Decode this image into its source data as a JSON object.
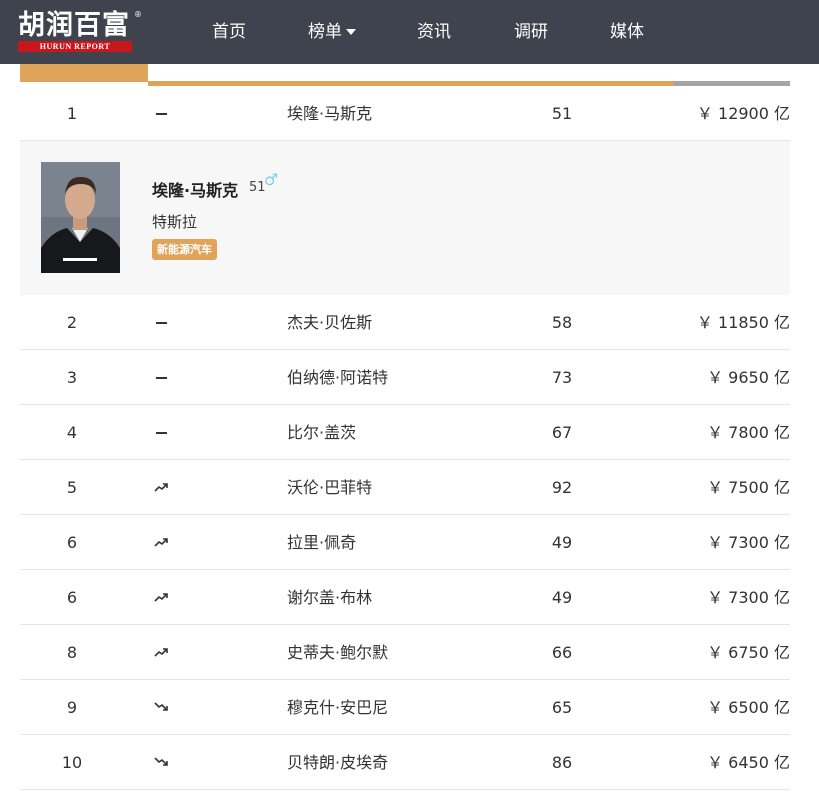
{
  "header": {
    "logo_cn": "胡润百富",
    "logo_en": "HURUN REPORT",
    "logo_reg": "®",
    "nav": [
      {
        "label": "首页"
      },
      {
        "label": "榜单"
      },
      {
        "label": "资讯"
      },
      {
        "label": "调研"
      },
      {
        "label": "媒体"
      }
    ]
  },
  "colors": {
    "header_bg": "#3e434d",
    "accent": "#e0a35a",
    "logo_red": "#c8161d",
    "gender_male": "#7fd0ea"
  },
  "detail": {
    "name": "埃隆·马斯克",
    "age": "51",
    "gender_symbol": "♂",
    "company": "特斯拉",
    "industry_tag": "新能源汽车"
  },
  "rows": [
    {
      "rank": "1",
      "trend": "flat",
      "name": "埃隆·马斯克",
      "age": "51",
      "wealth": "￥ 12900 亿"
    },
    {
      "rank": "2",
      "trend": "flat",
      "name": "杰夫·贝佐斯",
      "age": "58",
      "wealth": "￥ 11850 亿"
    },
    {
      "rank": "3",
      "trend": "flat",
      "name": "伯纳德·阿诺特",
      "age": "73",
      "wealth": "￥ 9650 亿"
    },
    {
      "rank": "4",
      "trend": "flat",
      "name": "比尔·盖茨",
      "age": "67",
      "wealth": "￥ 7800 亿"
    },
    {
      "rank": "5",
      "trend": "up",
      "name": "沃伦·巴菲特",
      "age": "92",
      "wealth": "￥ 7500 亿"
    },
    {
      "rank": "6",
      "trend": "up",
      "name": "拉里·佩奇",
      "age": "49",
      "wealth": "￥ 7300 亿"
    },
    {
      "rank": "6",
      "trend": "up",
      "name": "谢尔盖·布林",
      "age": "49",
      "wealth": "￥ 7300 亿"
    },
    {
      "rank": "8",
      "trend": "up",
      "name": "史蒂夫·鲍尔默",
      "age": "66",
      "wealth": "￥ 6750 亿"
    },
    {
      "rank": "9",
      "trend": "down",
      "name": "穆克什·安巴尼",
      "age": "65",
      "wealth": "￥ 6500 亿"
    },
    {
      "rank": "10",
      "trend": "down",
      "name": "贝特朗·皮埃奇",
      "age": "86",
      "wealth": "￥ 6450 亿"
    }
  ]
}
